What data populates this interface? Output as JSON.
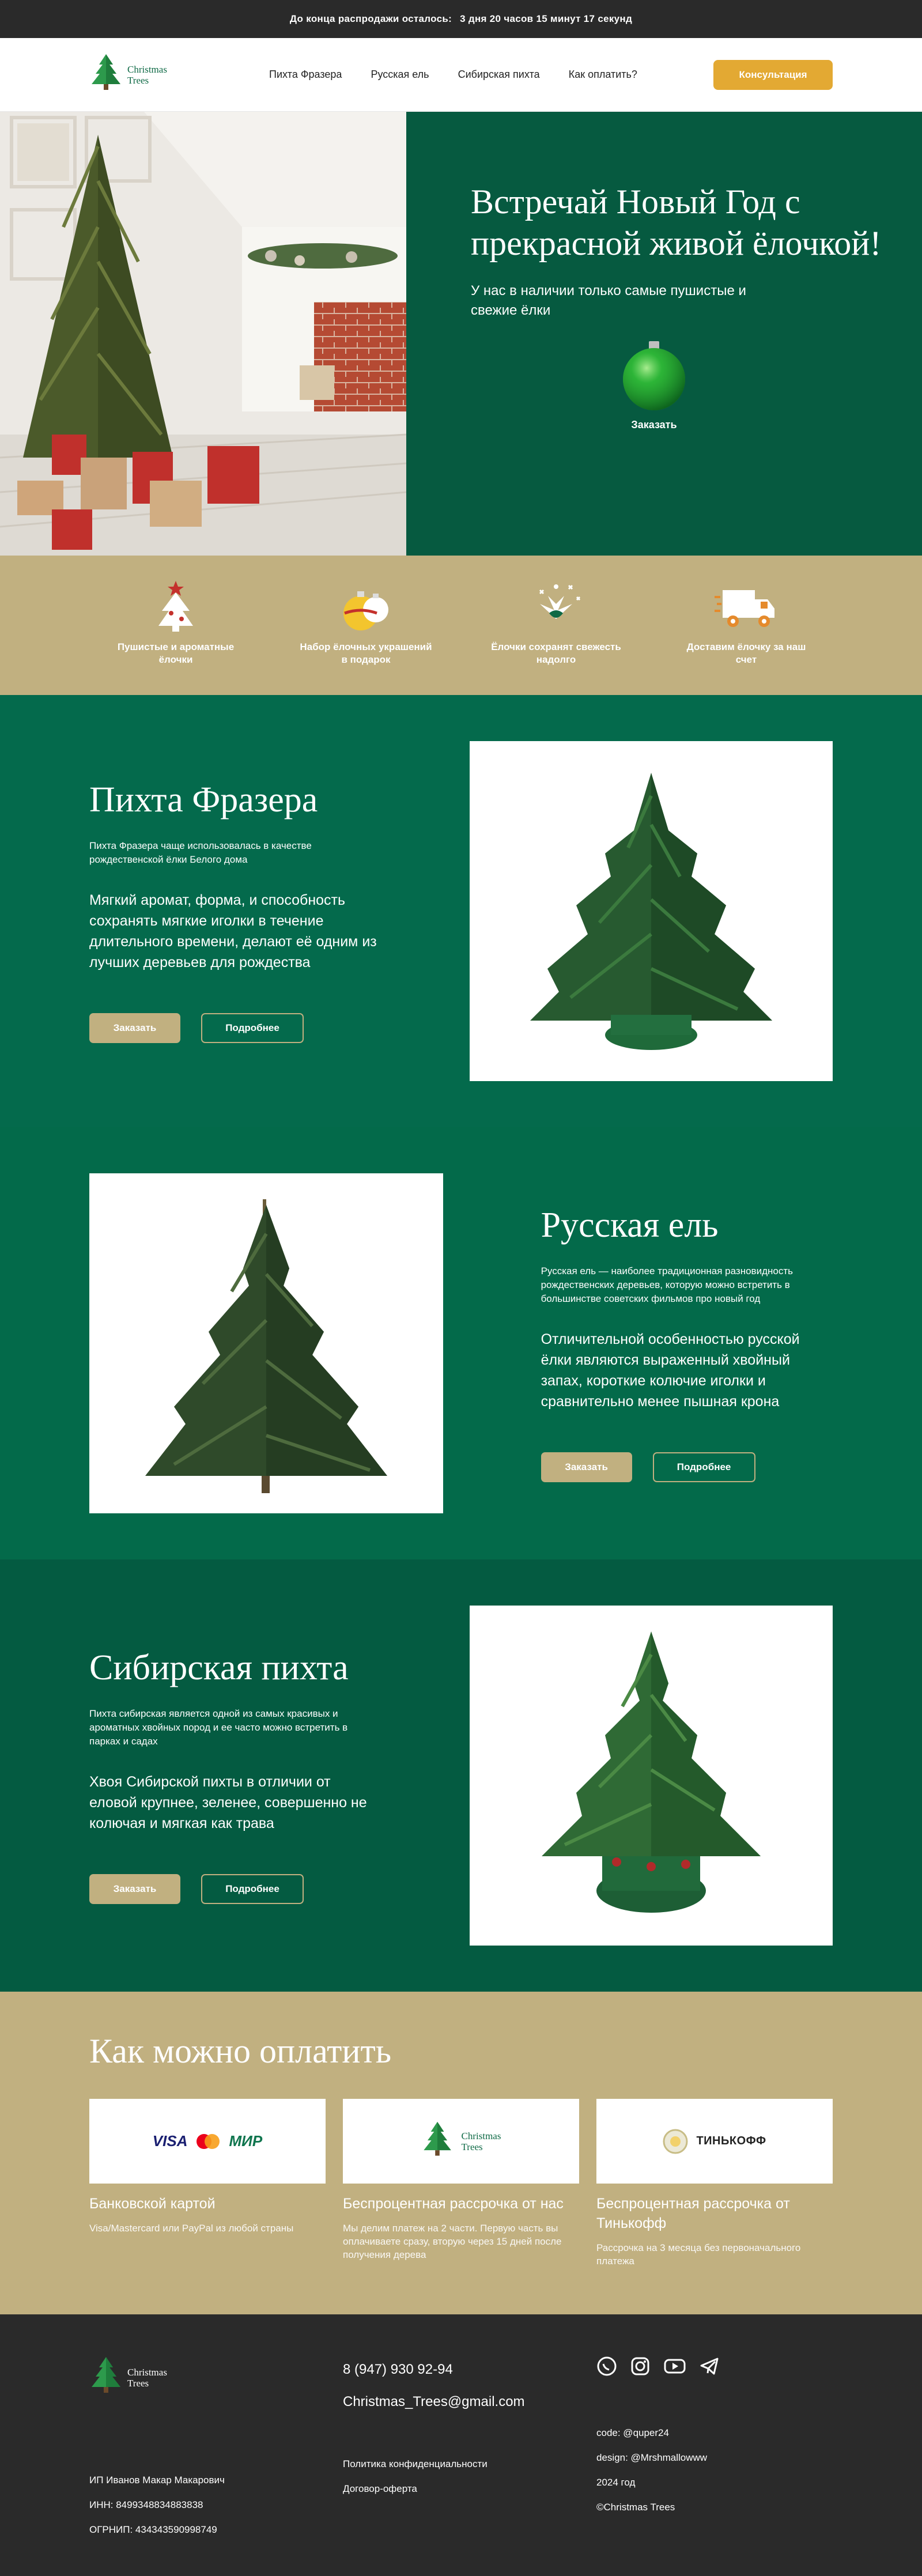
{
  "topbar": {
    "text": "До конца распродажи осталось:",
    "countdown": "3 дня 20 часов 15 минут 17 секунд"
  },
  "header": {
    "logo_line1": "Christmas",
    "logo_line2": "Trees",
    "nav": [
      "Пихта Фразера",
      "Русская ель",
      "Сибирская пихта",
      "Как оплатить?"
    ],
    "cta": "Консультация"
  },
  "hero": {
    "title": "Встречай Новый Год с прекрасной живой ёлочкой!",
    "subtitle": "У нас в наличии только самые пушистые и свежие ёлки",
    "order": "Заказать"
  },
  "features": [
    {
      "icon": "tree-icon",
      "label": "Пушистые и ароматные ёлочки"
    },
    {
      "icon": "ornaments-icon",
      "label": "Набор ёлочных украшений в подарок"
    },
    {
      "icon": "fresh-branch-icon",
      "label": "Ёлочки сохранят свежесть надолго"
    },
    {
      "icon": "delivery-truck-icon",
      "label": "Доставим ёлочку за наш счет"
    }
  ],
  "products": [
    {
      "title": "Пихта Фразера",
      "small": "Пихта Фразера чаще использовалась в качестве рождественской ёлки Белого дома",
      "desc": "Мягкий аромат, форма, и способность сохранять мягкие иголки в течение длительного времени, делают её одним из лучших деревьев для рождества",
      "order": "Заказать",
      "more": "Подробнее"
    },
    {
      "title": "Русская ель",
      "small": "Русская ель — наиболее традиционная разновидность рождественских деревьев, которую можно встретить в большинстве советских фильмов про новый год",
      "desc": "Отличительной особенностью русской ёлки являются выраженный хвойный запах, короткие колючие иголки и сравнительно менее пышная крона",
      "order": "Заказать",
      "more": "Подробнее"
    },
    {
      "title": "Сибирская пихта",
      "small": "Пихта сибирская является одной из самых красивых и ароматных хвойных пород и ее часто можно встретить в парках и садах",
      "desc": "Хвоя Сибирской пихты в отличии от еловой крупнее, зеленее, совершенно не колючая и мягкая как трава",
      "order": "Заказать",
      "more": "Подробнее"
    }
  ],
  "payment": {
    "title": "Как можно оплатить",
    "cards": [
      {
        "logo1": "VISA",
        "logo3": "МИР",
        "name": "Банковской картой",
        "note": "Visa/Mastercard или PayPal из любой страны"
      },
      {
        "logo_line1": "Christmas",
        "logo_line2": "Trees",
        "name": "Беспроцентная рассрочка от нас",
        "note": "Мы делим платеж на 2 части. Первую часть вы оплачиваете сразу, вторую через 15 дней после получения дерева"
      },
      {
        "logo": "ТИНЬКОФФ",
        "name": "Беспроцентная рассрочка от Тинькофф",
        "note": "Рассрочка на 3 месяца без первоначального платежа"
      }
    ]
  },
  "footer": {
    "logo_line1": "Christmas",
    "logo_line2": "Trees",
    "phone": "8 (947) 930 92-94",
    "email": "Christmas_Trees@gmail.com",
    "company": [
      "ИП Иванов Макар Макарович",
      "ИНН: 8499348834883838",
      "ОГРНИП: 434343590998749"
    ],
    "links": [
      "Политика конфиденциальности",
      "Договор-оферта"
    ],
    "credits": [
      "code: @quper24",
      "design: @Mrshmallowww",
      "2024 год",
      "©Christmas Trees"
    ],
    "social": [
      "whatsapp-icon",
      "instagram-icon",
      "youtube-icon",
      "telegram-icon"
    ]
  },
  "colors": {
    "dark_green": "#065a40",
    "green": "#046a4c",
    "sand": "#c1b080",
    "accent": "#e3a933",
    "dark": "#2a2a2a"
  }
}
